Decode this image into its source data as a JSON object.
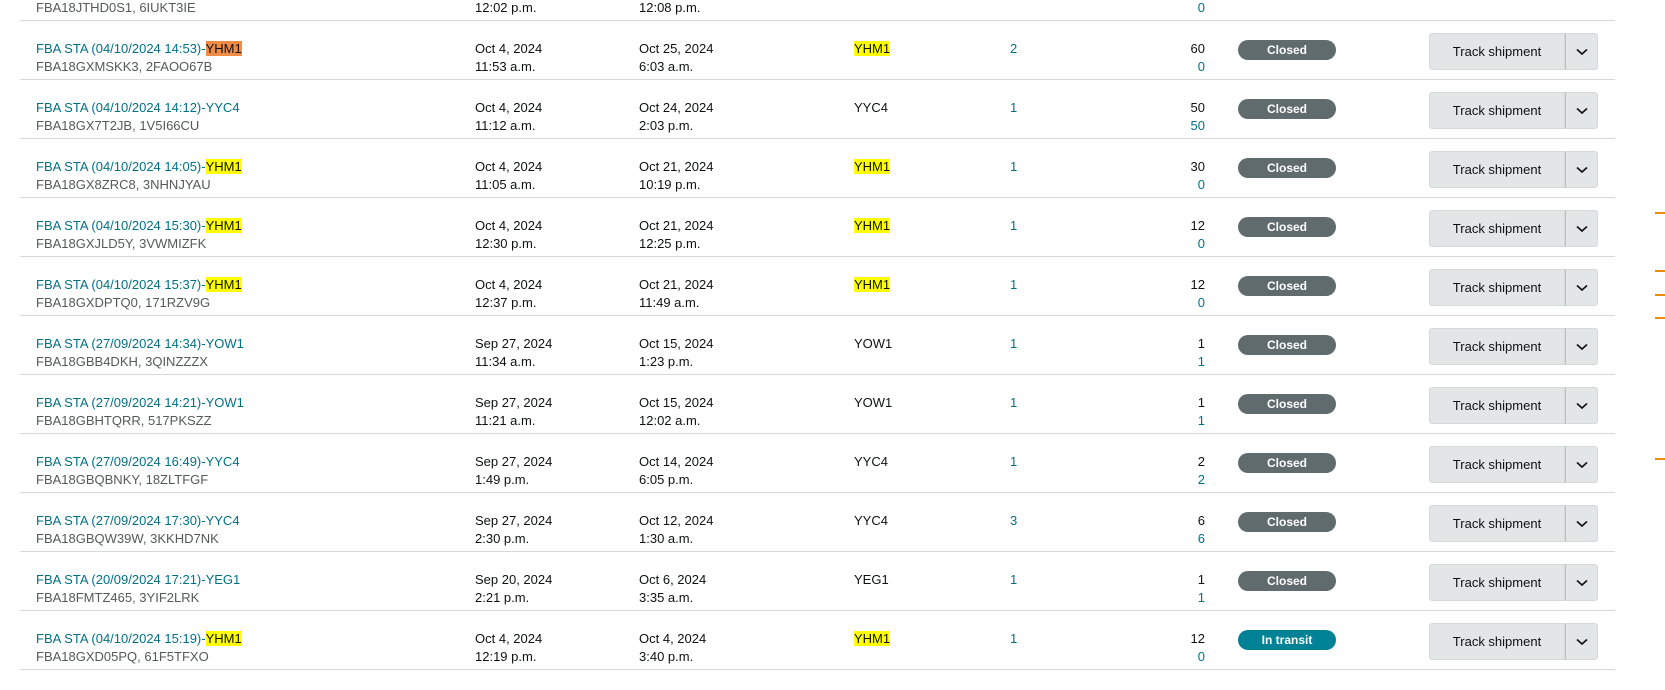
{
  "top_partial": {
    "name_sub": "FBA18JTHD0S1, 6IUKT3IE",
    "created_time": "12:02 p.m.",
    "updated_time": "12:08 p.m.",
    "units_received": "0"
  },
  "track_label": "Track shipment",
  "rows": [
    {
      "name_prefix": "FBA STA (04/10/2024 14:53)-",
      "name_hl": "YHM1",
      "hl_active": true,
      "ids": "FBA18GXMSKK3, 2FAOO67B",
      "created_date": "Oct 4, 2024",
      "created_time": "11:53 a.m.",
      "updated_date": "Oct 25, 2024",
      "updated_time": "6:03 a.m.",
      "dest": "YHM1",
      "dest_hl": true,
      "boxes": "2",
      "units": "60",
      "received": "0",
      "status": "Closed"
    },
    {
      "name_prefix": "FBA STA (04/10/2024 14:12)-YYC4",
      "name_hl": "",
      "hl_active": false,
      "ids": "FBA18GX7T2JB, 1V5I66CU",
      "created_date": "Oct 4, 2024",
      "created_time": "11:12 a.m.",
      "updated_date": "Oct 24, 2024",
      "updated_time": "2:03 p.m.",
      "dest": "YYC4",
      "dest_hl": false,
      "boxes": "1",
      "units": "50",
      "received": "50",
      "status": "Closed"
    },
    {
      "name_prefix": "FBA STA (04/10/2024 14:05)-",
      "name_hl": "YHM1",
      "hl_active": false,
      "ids": "FBA18GX8ZRC8, 3NHNJYAU",
      "created_date": "Oct 4, 2024",
      "created_time": "11:05 a.m.",
      "updated_date": "Oct 21, 2024",
      "updated_time": "10:19 p.m.",
      "dest": "YHM1",
      "dest_hl": true,
      "boxes": "1",
      "units": "30",
      "received": "0",
      "status": "Closed"
    },
    {
      "name_prefix": "FBA STA (04/10/2024 15:30)-",
      "name_hl": "YHM1",
      "hl_active": false,
      "ids": "FBA18GXJLD5Y, 3VWMIZFK",
      "created_date": "Oct 4, 2024",
      "created_time": "12:30 p.m.",
      "updated_date": "Oct 21, 2024",
      "updated_time": "12:25 p.m.",
      "dest": "YHM1",
      "dest_hl": true,
      "boxes": "1",
      "units": "12",
      "received": "0",
      "status": "Closed"
    },
    {
      "name_prefix": "FBA STA (04/10/2024 15:37)-",
      "name_hl": "YHM1",
      "hl_active": false,
      "ids": "FBA18GXDPTQ0, 171RZV9G",
      "created_date": "Oct 4, 2024",
      "created_time": "12:37 p.m.",
      "updated_date": "Oct 21, 2024",
      "updated_time": "11:49 a.m.",
      "dest": "YHM1",
      "dest_hl": true,
      "boxes": "1",
      "units": "12",
      "received": "0",
      "status": "Closed"
    },
    {
      "name_prefix": "FBA STA (27/09/2024 14:34)-YOW1",
      "name_hl": "",
      "hl_active": false,
      "ids": "FBA18GBB4DKH, 3QINZZZX",
      "created_date": "Sep 27, 2024",
      "created_time": "11:34 a.m.",
      "updated_date": "Oct 15, 2024",
      "updated_time": "1:23 p.m.",
      "dest": "YOW1",
      "dest_hl": false,
      "boxes": "1",
      "units": "1",
      "received": "1",
      "status": "Closed"
    },
    {
      "name_prefix": "FBA STA (27/09/2024 14:21)-YOW1",
      "name_hl": "",
      "hl_active": false,
      "ids": "FBA18GBHTQRR, 517PKSZZ",
      "created_date": "Sep 27, 2024",
      "created_time": "11:21 a.m.",
      "updated_date": "Oct 15, 2024",
      "updated_time": "12:02 a.m.",
      "dest": "YOW1",
      "dest_hl": false,
      "boxes": "1",
      "units": "1",
      "received": "1",
      "status": "Closed"
    },
    {
      "name_prefix": "FBA STA (27/09/2024 16:49)-YYC4",
      "name_hl": "",
      "hl_active": false,
      "ids": "FBA18GBQBNKY, 18ZLTFGF",
      "created_date": "Sep 27, 2024",
      "created_time": "1:49 p.m.",
      "updated_date": "Oct 14, 2024",
      "updated_time": "6:05 p.m.",
      "dest": "YYC4",
      "dest_hl": false,
      "boxes": "1",
      "units": "2",
      "received": "2",
      "status": "Closed"
    },
    {
      "name_prefix": "FBA STA (27/09/2024 17:30)-YYC4",
      "name_hl": "",
      "hl_active": false,
      "ids": "FBA18GBQW39W, 3KKHD7NK",
      "created_date": "Sep 27, 2024",
      "created_time": "2:30 p.m.",
      "updated_date": "Oct 12, 2024",
      "updated_time": "1:30 a.m.",
      "dest": "YYC4",
      "dest_hl": false,
      "boxes": "3",
      "units": "6",
      "received": "6",
      "status": "Closed"
    },
    {
      "name_prefix": "FBA STA (20/09/2024 17:21)-YEG1",
      "name_hl": "",
      "hl_active": false,
      "ids": "FBA18FMTZ465, 3YIF2LRK",
      "created_date": "Sep 20, 2024",
      "created_time": "2:21 p.m.",
      "updated_date": "Oct 6, 2024",
      "updated_time": "3:35 a.m.",
      "dest": "YEG1",
      "dest_hl": false,
      "boxes": "1",
      "units": "1",
      "received": "1",
      "status": "Closed"
    },
    {
      "name_prefix": "FBA STA (04/10/2024 15:19)-",
      "name_hl": "YHM1",
      "hl_active": false,
      "ids": "FBA18GXD05PQ, 61F5TFXO",
      "created_date": "Oct 4, 2024",
      "created_time": "12:19 p.m.",
      "updated_date": "Oct 4, 2024",
      "updated_time": "3:40 p.m.",
      "dest": "YHM1",
      "dest_hl": true,
      "boxes": "1",
      "units": "12",
      "received": "0",
      "status": "In transit"
    }
  ],
  "colors": {
    "link": "#007185",
    "closed_badge": "#5f6b6d",
    "transit_badge": "#008296",
    "highlight": "#ffff00",
    "highlight_active": "#f08c46"
  }
}
